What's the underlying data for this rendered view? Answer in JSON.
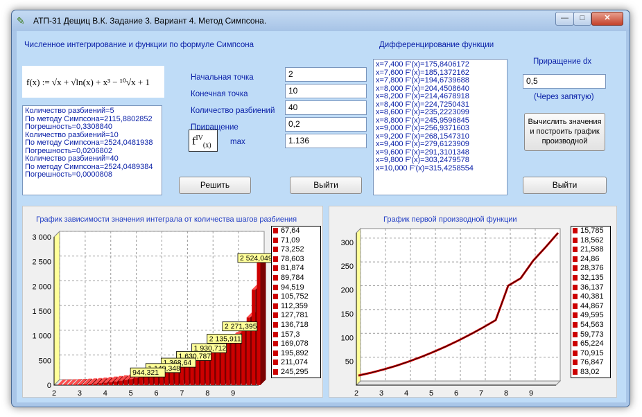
{
  "window": {
    "title": "АТП-31 Дещиц В.К. Задание 3. Вариант 4. Метод Симпсона.",
    "icon": "app-icon",
    "controls": {
      "minimize": "—",
      "maximize": "□",
      "close": "✕"
    }
  },
  "integration": {
    "heading": "Численное интегрирование и функции по формуле Симпсона",
    "formula": "f(x) := √x + √ln(x) + x³ − ¹⁰√x + 1",
    "results": [
      "Количество разбиений=5",
      "По методу Симпсона=2115,8802852",
      "Погрешность=0,3308840",
      "Количество разбиений=10",
      "По методу Симпсона=2524,0481938",
      "Погрешность=0,0206802",
      "Количество разбиений=40",
      "По методу Симпсона=2524,0489384",
      "Погрешность=0,0000808"
    ]
  },
  "params": {
    "start_label": "Начальная точка",
    "start_value": "2",
    "end_label": "Конечная точка",
    "end_value": "10",
    "partitions_label": "Количество разбиений",
    "partitions_value": "40",
    "increment_label": "Приращение",
    "increment_value": "0,2",
    "fiv_label": "f",
    "fiv_sup": "IV",
    "fiv_arg": "(x)",
    "max_label": "max",
    "max_value": "1.136"
  },
  "buttons": {
    "solve": "Решить",
    "exit1": "Выйти",
    "compute": "Вычислить значения и построить график производной",
    "exit2": "Выйти"
  },
  "derivative": {
    "heading": "Дифференцирование функции",
    "lines": [
      "x=7,400  F'(x)=175,8406172",
      "x=7,600  F'(x)=185,1372162",
      "x=7,800  F'(x)=194,6739688",
      "x=8,000  F'(x)=204,4508640",
      "x=8,200  F'(x)=214,4678918",
      "x=8,400  F'(x)=224,7250431",
      "x=8,600  F'(x)=235,2223099",
      "x=8,800  F'(x)=245,9596845",
      "x=9,000  F'(x)=256,9371603",
      "x=9,200  F'(x)=268,1547310",
      "x=9,400  F'(x)=279,6123909",
      "x=9,600  F'(x)=291,3101348",
      "x=9,800  F'(x)=303,2479578",
      "x=10,000  F'(x)=315,4258554"
    ],
    "dx_label": "Приращение dx",
    "dx_value": "0,5",
    "dx_hint": "(Через запятую)"
  },
  "chart_data": [
    {
      "type": "bar",
      "title": "График зависимости значения интеграла от количества шагов разбиения",
      "x_range": [
        2,
        10
      ],
      "ylim": [
        0,
        3000
      ],
      "x_ticks": [
        "2",
        "3",
        "4",
        "5",
        "6",
        "7",
        "8",
        "9"
      ],
      "y_ticks": [
        "0",
        "500",
        "1 000",
        "1 500",
        "2 000",
        "2 500",
        "3 000"
      ],
      "grid": true,
      "color": "#cc0000",
      "x": [
        2.2,
        2.4,
        2.6,
        2.8,
        3.0,
        3.2,
        3.4,
        3.6,
        3.8,
        4.0,
        4.2,
        4.4,
        4.6,
        4.8,
        5.0,
        5.2,
        5.4,
        5.6,
        5.8,
        6.0,
        6.2,
        6.4,
        6.6,
        6.8,
        7.0,
        7.2,
        7.4,
        7.6,
        7.8,
        8.0,
        8.2,
        8.4,
        8.6,
        8.8,
        9.0,
        9.2,
        9.4,
        9.6,
        9.8,
        10.0
      ],
      "values": [
        2,
        4,
        7,
        10,
        14,
        19,
        25,
        32,
        40,
        50,
        61,
        73,
        87,
        102,
        120,
        139,
        160,
        183,
        208,
        236,
        265,
        297,
        331,
        367,
        406,
        448,
        493,
        540,
        590,
        644,
        700,
        761,
        825,
        892,
        964,
        1039,
        1140,
        1369,
        1931,
        2524
      ],
      "data_labels": [
        "2 524,049",
        "2 271,395",
        "2 135,911",
        "1 930,712",
        "1 630,787",
        "1 368,64",
        "1 140,348",
        "944,321"
      ],
      "legend_position": "right",
      "legend": [
        "67,64",
        "71,09",
        "73,252",
        "78,603",
        "81,874",
        "89,784",
        "94,519",
        "105,752",
        "112,359",
        "127,781",
        "136,718",
        "157,3",
        "169,078",
        "195,892",
        "211,074",
        "245,295"
      ]
    },
    {
      "type": "line",
      "title": "График первой производной функции",
      "x_range": [
        2,
        10
      ],
      "ylim": [
        0,
        320
      ],
      "x_ticks": [
        "2",
        "3",
        "4",
        "5",
        "6",
        "7",
        "8",
        "9"
      ],
      "y_ticks": [
        "50",
        "100",
        "150",
        "200",
        "250",
        "300"
      ],
      "grid": true,
      "color": "#cc0000",
      "x": [
        2,
        2.5,
        3,
        3.5,
        4,
        4.5,
        5,
        5.5,
        6,
        6.5,
        7,
        7.5,
        8,
        8.5,
        9,
        9.5,
        10
      ],
      "y": [
        15.8,
        21.6,
        28.4,
        36.1,
        44.9,
        54.6,
        65.2,
        76.8,
        89.2,
        102.6,
        116.9,
        132.2,
        204.5,
        220,
        256.9,
        285.5,
        315.4
      ],
      "legend_position": "right",
      "legend": [
        "15,785",
        "18,562",
        "21,588",
        "24,86",
        "28,376",
        "32,135",
        "36,137",
        "40,381",
        "44,867",
        "49,595",
        "54,563",
        "59,773",
        "65,224",
        "70,915",
        "76,847",
        "83,02"
      ]
    }
  ]
}
